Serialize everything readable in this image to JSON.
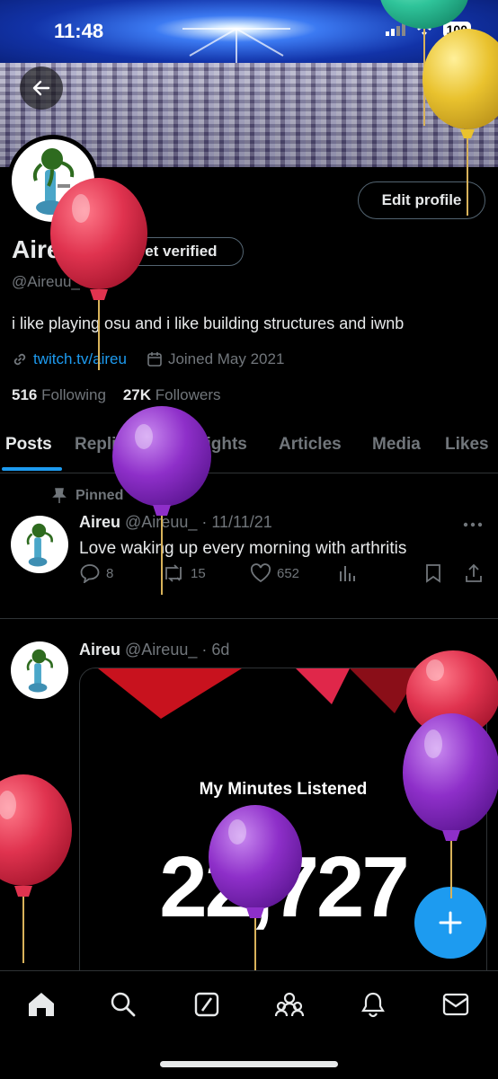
{
  "status_bar": {
    "time": "11:48",
    "battery": "100"
  },
  "profile": {
    "name": "Aireu",
    "get_verified_label": "Get verified",
    "handle": "@Aireuu_",
    "bio": "i like playing osu and i like building structures and iwnb",
    "link": "twitch.tv/aireu",
    "joined": "Joined May 2021",
    "following_count": "516",
    "following_label": "Following",
    "followers_count": "27K",
    "followers_label": "Followers",
    "edit_profile_label": "Edit profile"
  },
  "tabs": [
    {
      "label": "Posts",
      "active": true
    },
    {
      "label": "Replies"
    },
    {
      "label": "Highlights"
    },
    {
      "label": "Articles"
    },
    {
      "label": "Media"
    },
    {
      "label": "Likes"
    }
  ],
  "pinned_label": "Pinned",
  "posts": [
    {
      "author": "Aireu",
      "handle": "@Aireuu_",
      "date": "· 11/11/21",
      "text": "Love waking up every morning with arthritis",
      "replies": "8",
      "reposts": "15",
      "likes": "652"
    },
    {
      "author": "Aireu",
      "handle": "@Aireuu_",
      "date": "· 6d",
      "media_title": "My Minutes Listened",
      "media_value": "22,727"
    }
  ],
  "colors": {
    "accent": "#1d9bf0",
    "balloon_red": "#e0334f",
    "balloon_purple": "#8e2fc9",
    "balloon_yellow": "#e9c22e",
    "balloon_teal": "#2fc49a"
  },
  "icons": [
    "back-arrow-icon",
    "search-icon",
    "verified-badge-icon",
    "link-icon",
    "calendar-icon",
    "pin-icon",
    "more-icon",
    "reply-icon",
    "repost-icon",
    "like-icon",
    "views-icon",
    "bookmark-icon",
    "share-icon",
    "plus-icon",
    "home-icon",
    "explore-icon",
    "grok-icon",
    "communities-icon",
    "notifications-icon",
    "messages-icon"
  ]
}
